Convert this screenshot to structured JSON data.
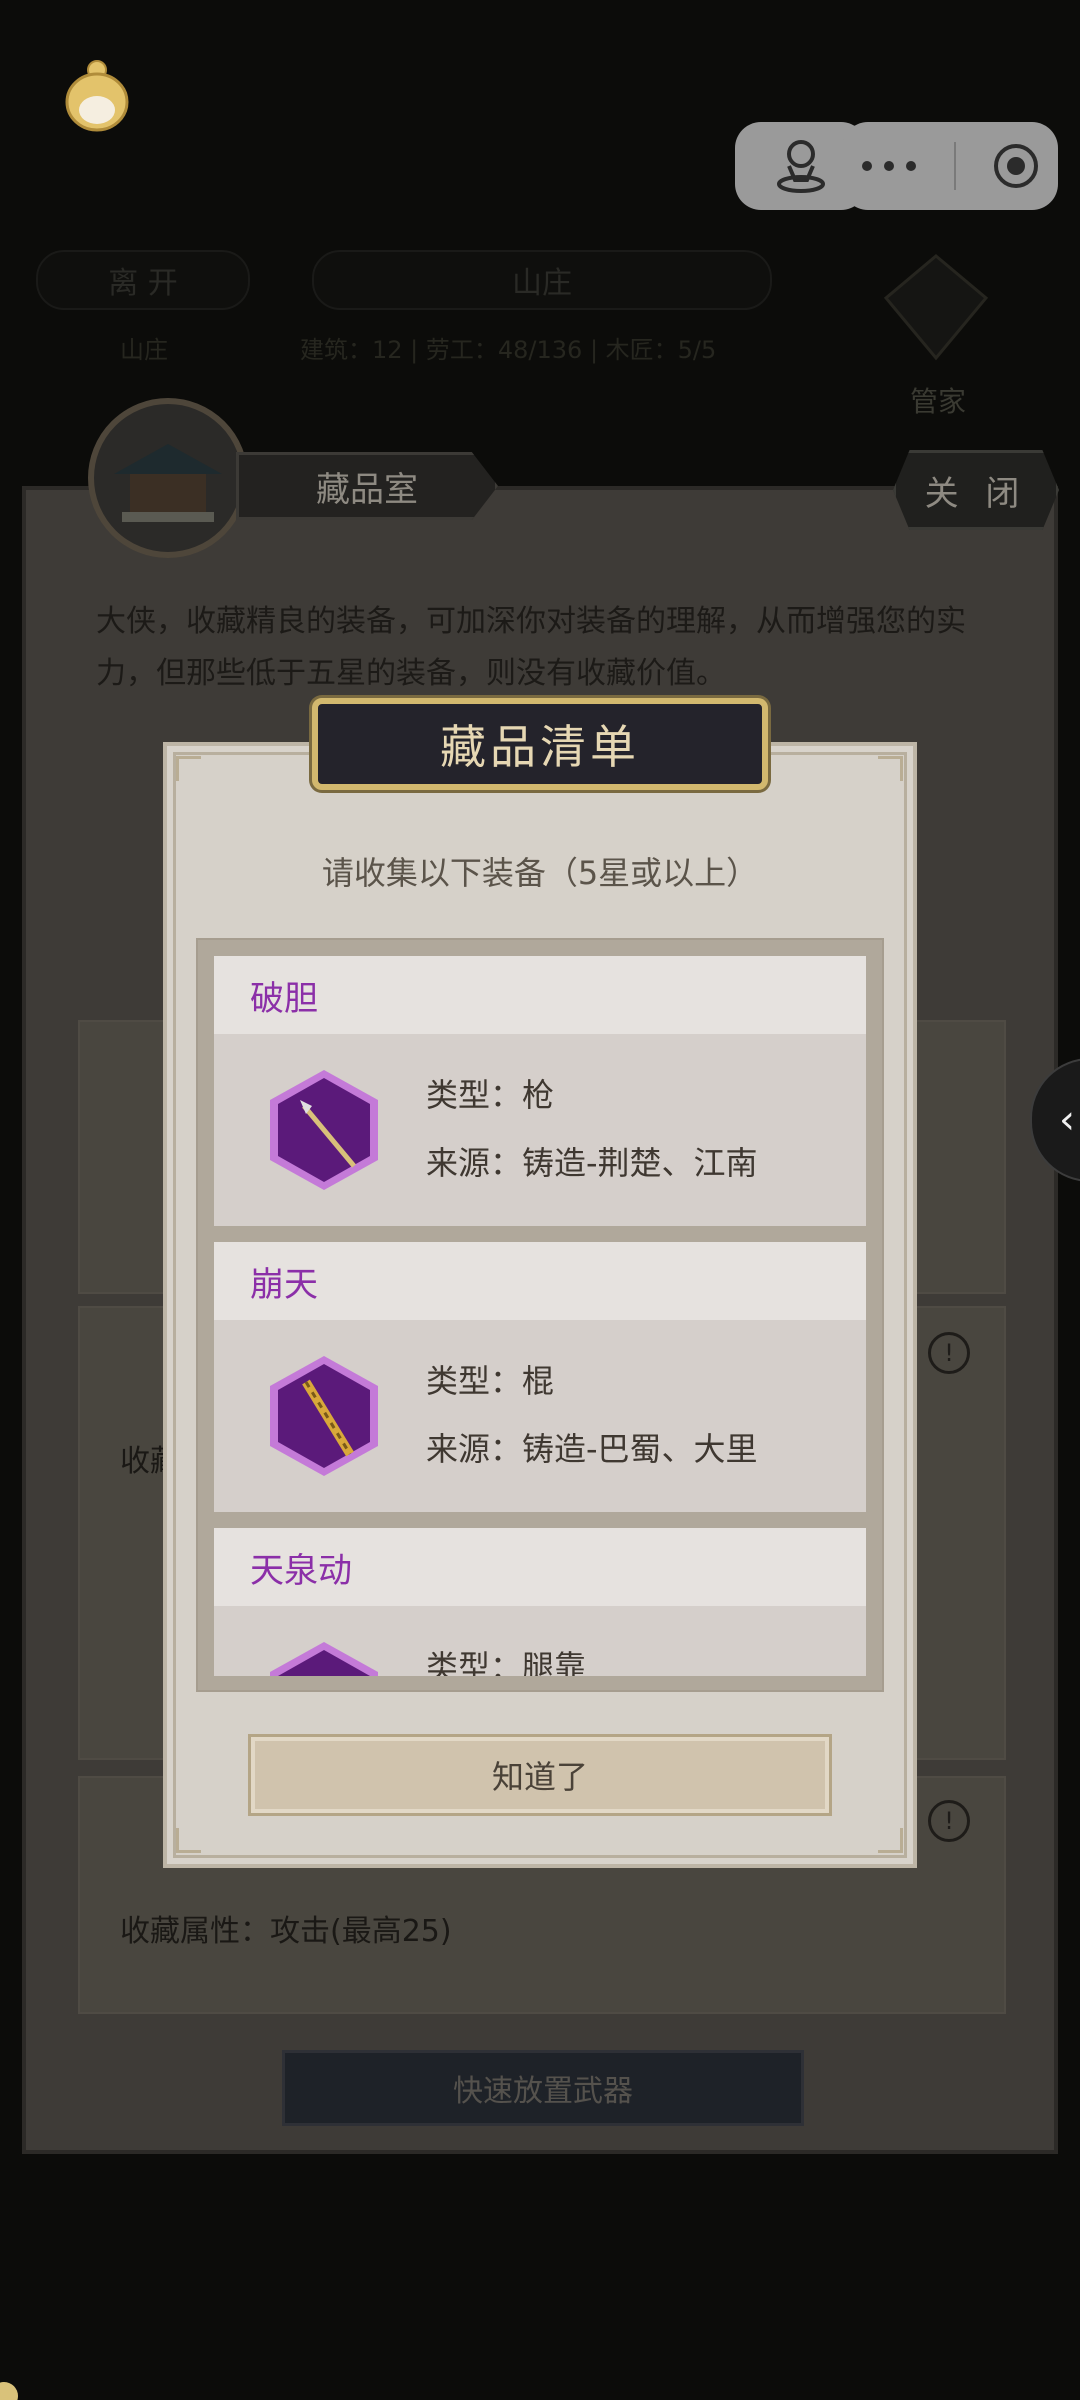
{
  "topbar": {
    "person_icon": "person-pin-icon",
    "more_icon": "more-dots-icon",
    "target_icon": "record-target-icon"
  },
  "header": {
    "leave_label": "离 开",
    "villa_label": "山庄",
    "left_sub": "山庄",
    "stats": "建筑：12  |  劳工：48/136  |  木匠：5/5",
    "manager_label": "管家"
  },
  "panel": {
    "tab_title": "藏品室",
    "close_label": "关 闭",
    "intro": "大侠，收藏精良的装备，可加深你对装备的理解，从而增强您的实力，但那些低于五星的装备，则没有收藏价值。",
    "card_text_1": "收藏",
    "card_text_2": "收藏属性：攻击(最高25)",
    "quick_place_label": "快速放置武器"
  },
  "modal": {
    "title": "藏品清单",
    "subtitle": "请收集以下装备（5星或以上）",
    "items": [
      {
        "name": "破胆",
        "type": "类型：枪",
        "source": "来源：铸造-荆楚、江南",
        "icon": "spear-icon"
      },
      {
        "name": "崩天",
        "type": "类型：棍",
        "source": "来源：铸造-巴蜀、大里",
        "icon": "staff-icon"
      },
      {
        "name": "天泉动",
        "type": "类型：腿靠",
        "source": "",
        "icon": "leg-guard-icon"
      }
    ],
    "ok_label": "知道了"
  },
  "colors": {
    "item_name": "#8b2fa8",
    "hex_fill": "#5b1a7a",
    "hex_border": "#b13fd0",
    "title_bg": "#24232b",
    "title_border": "#d2b86e"
  }
}
